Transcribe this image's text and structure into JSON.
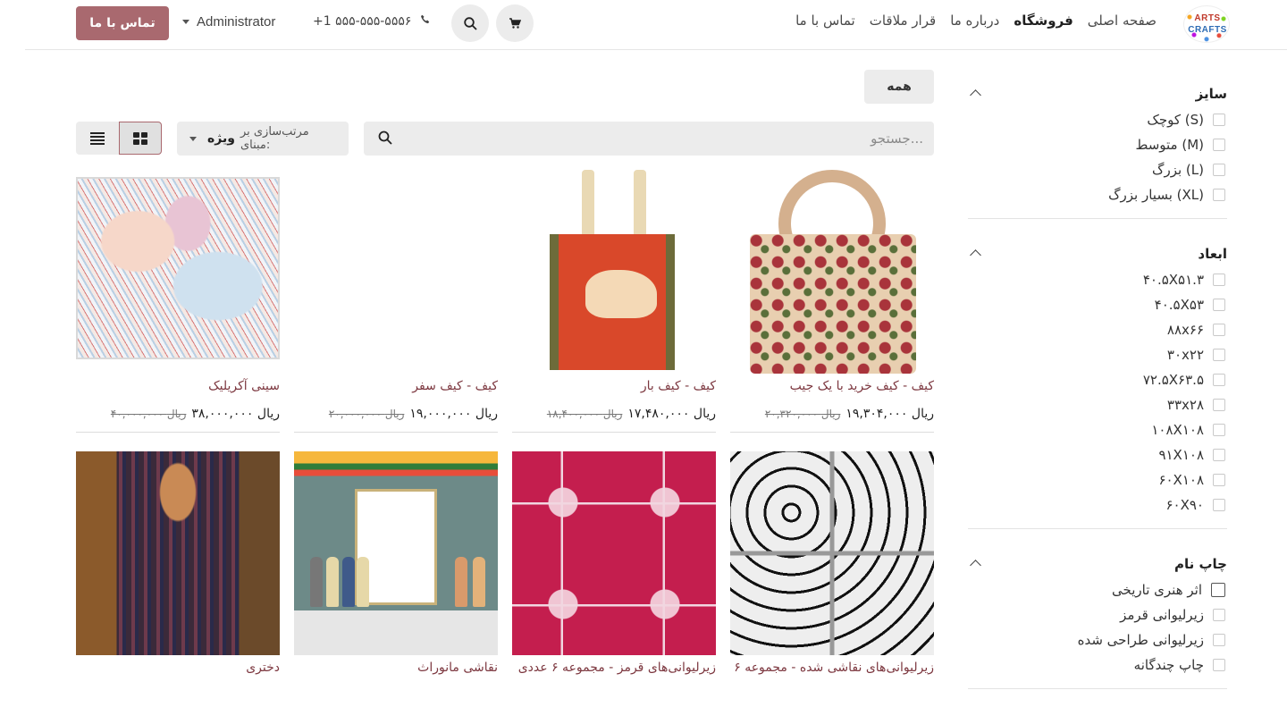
{
  "brand": {
    "logo_line1": "ARTS",
    "logo_line2": "CRAFTS"
  },
  "nav": [
    {
      "label": "صفحه اصلی",
      "active": false
    },
    {
      "label": "فروشگاه",
      "active": true
    },
    {
      "label": "درباره ما",
      "active": false
    },
    {
      "label": "قرار ملاقات",
      "active": false
    },
    {
      "label": "تماس با ما",
      "active": false
    }
  ],
  "header": {
    "phone": "+1 ۵۵۵-۵۵۵-۵۵۵۶",
    "user": "Administrator",
    "contact_button": "تماس با ما",
    "accent_color": "#a9696f"
  },
  "toolbar": {
    "all_label": "همه",
    "search_placeholder": "جستجو...",
    "sort_prefix": "مرتب‌سازی بر مبنای:",
    "sort_value": "ویژه"
  },
  "filters": [
    {
      "title": "سایز",
      "options": [
        "کوچک (S)",
        "متوسط (M)",
        "بزرگ (L)",
        "بسیار بزرگ (XL)"
      ]
    },
    {
      "title": "ابعاد",
      "options": [
        "۴۰.۵X۵۱.۳",
        "۴۰.۵X۵۳",
        "۸۸x۶۶",
        "۳۰x۲۲",
        "۷۲.۵X۶۳.۵",
        "۳۳x۲۸",
        "۱۰۸X۱۰۸",
        "۹۱X۱۰۸",
        "۶۰X۱۰۸",
        "۶۰X۹۰"
      ]
    },
    {
      "title": "چاپ نام",
      "options": [
        "اثر هنری تاریخی",
        "زیرلیوانی قرمز",
        "زیرلیوانی طراحی شده",
        "چاپ چندگانه"
      ]
    }
  ],
  "products": [
    {
      "name": "کیف - کیف خرید با یک جیب",
      "price": "۱۹,۳۰۴,۰۰۰ ریال",
      "old_price": "۲۰,۳۲۰,۰۰۰ ریال",
      "image": "floral-shopping-bag"
    },
    {
      "name": "کیف - کیف بار",
      "price": "۱۷,۴۸۰,۰۰۰ ریال",
      "old_price": "۱۸,۴۰۰,۰۰۰ ریال",
      "image": "red-cow-tote"
    },
    {
      "name": "کیف - کیف سفر",
      "price": "۱۹,۰۰۰,۰۰۰ ریال",
      "old_price": "۲۰,۰۰۰,۰۰۰ ریال",
      "image": "patchwork-travel-bag"
    },
    {
      "name": "سینی آکریلیک",
      "price": "۳۸,۰۰۰,۰۰۰ ریال",
      "old_price": "۴۰,۰۰۰,۰۰۰ ریال",
      "image": "acrylic-tray"
    },
    {
      "name": "زیرلیوانی‌های نقاشی شده - مجموعه ۶",
      "price": "",
      "old_price": "",
      "image": "painted-coasters"
    },
    {
      "name": "زیرلیوانی‌های قرمز - مجموعه ۶ عددی",
      "price": "",
      "old_price": "",
      "image": "red-coasters"
    },
    {
      "name": "نقاشی مانوراث",
      "price": "",
      "old_price": "",
      "image": "manorath-painting"
    },
    {
      "name": "دختری",
      "price": "",
      "old_price": "",
      "image": "girl-portrait"
    }
  ]
}
